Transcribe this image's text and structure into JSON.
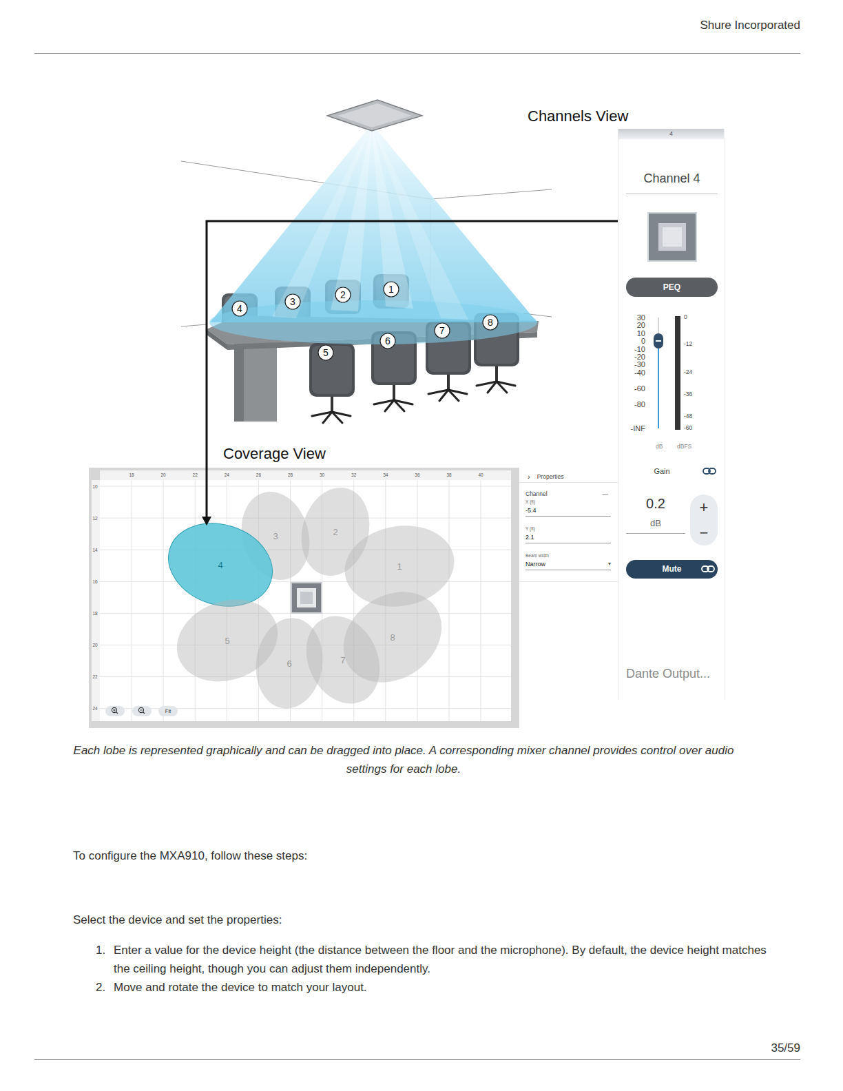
{
  "header": {
    "company": "Shure Incorporated"
  },
  "figure": {
    "channels_view_label": "Channels View",
    "coverage_view_label": "Coverage View",
    "chairs": [
      {
        "label": "1"
      },
      {
        "label": "2"
      },
      {
        "label": "3"
      },
      {
        "label": "4"
      },
      {
        "label": "5"
      },
      {
        "label": "6"
      },
      {
        "label": "7"
      },
      {
        "label": "8"
      }
    ],
    "channel_strip": {
      "header": "4",
      "title": "Channel 4",
      "peq_button": "PEQ",
      "fader": {
        "ticks": [
          "30",
          "20",
          "10",
          "0",
          "-10",
          "-20",
          "-30",
          "-40",
          "-60",
          "-80",
          "-INF"
        ],
        "level": 0.79,
        "unit": "dB"
      },
      "meter": {
        "ticks": [
          "0",
          "-12",
          "-24",
          "-36",
          "-48",
          "-60"
        ],
        "level": 0,
        "unit": "dBFS"
      },
      "gain_label": "Gain",
      "gain_value": "0.2",
      "gain_unit": "dB",
      "increment": "+",
      "decrement": "−",
      "mute_button": "Mute",
      "output": "Dante Output..."
    },
    "coverage": {
      "x_ticks": [
        "18",
        "20",
        "22",
        "24",
        "26",
        "28",
        "30",
        "32",
        "34",
        "36",
        "38",
        "40"
      ],
      "y_ticks": [
        "10",
        "12",
        "14",
        "16",
        "18",
        "20",
        "22",
        "24"
      ],
      "lobes": [
        {
          "label": "1",
          "selected": false
        },
        {
          "label": "2",
          "selected": false
        },
        {
          "label": "3",
          "selected": false
        },
        {
          "label": "4",
          "selected": true
        },
        {
          "label": "5",
          "selected": false
        },
        {
          "label": "6",
          "selected": false
        },
        {
          "label": "7",
          "selected": false
        },
        {
          "label": "8",
          "selected": false
        }
      ],
      "fit_button": "Fit"
    },
    "properties": {
      "expander": "›",
      "title": "Properties",
      "section": "Channel",
      "collapse": "—",
      "fields": [
        {
          "label": "X (ft)",
          "value": "-5.4"
        },
        {
          "label": "Y (ft)",
          "value": "2.1"
        }
      ],
      "beam_width": {
        "label": "Beam width",
        "value": "Narrow",
        "arrow": "▾"
      }
    }
  },
  "caption": "Each lobe is represented graphically and can be dragged into place. A corresponding mixer channel provides control over audio settings for each lobe.",
  "intro": "To configure the MXA910, follow these steps:",
  "subheading": "Select the device and set the properties:",
  "steps": [
    {
      "number": "1.",
      "text": "Enter a value for the device height (the distance between the floor and the microphone). By default, the device height matches the ceiling height, though you can adjust them independently."
    },
    {
      "number": "2.",
      "text": "Move and rotate the device to match your layout."
    }
  ],
  "page_number": "35/59"
}
